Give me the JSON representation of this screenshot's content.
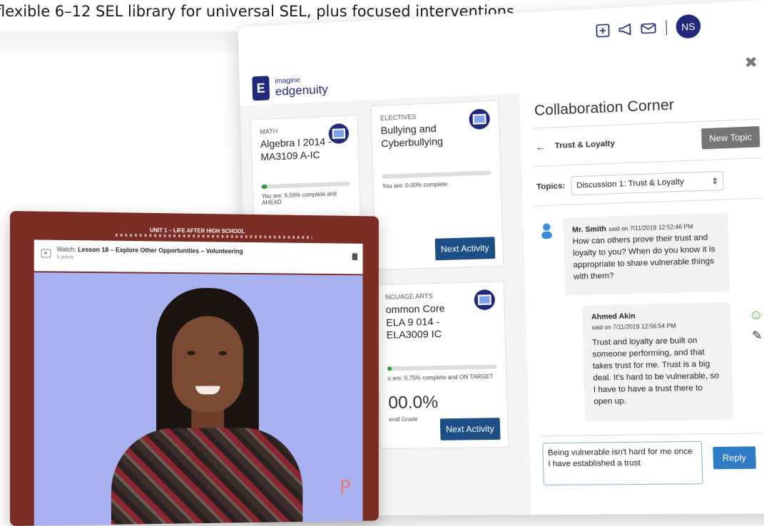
{
  "headline": "flexible 6–12 SEL library for universal SEL, plus focused interventions",
  "header": {
    "icons": [
      "plus-square-icon",
      "megaphone-icon",
      "envelope-icon"
    ],
    "avatar_initials": "NS"
  },
  "logo": {
    "small": "imagine",
    "big": "edgenuity"
  },
  "courses": [
    {
      "category": "MATH",
      "title": "Algebra I 2014 - MA3109 A-IC",
      "progress_percent": 6.56,
      "progress_text": "You are: 6.56% complete and AHEAD"
    },
    {
      "category": "ELECTIVES",
      "title": "Bullying and Cyberbullying",
      "progress_percent": 0,
      "progress_text": "You are: 0.00% complete",
      "button": "Next Activity"
    },
    {
      "category": "NGUAGE ARTS",
      "title": "ommon Core ELA 9 014 - ELA3009 IC",
      "progress_percent": 0.75,
      "progress_text": "u are: 0.75% complete and ON TARGET",
      "grade": "00.0%",
      "grade_label": "erall Grade",
      "button": "Next Activity"
    }
  ],
  "collab": {
    "title": "Collaboration Corner",
    "back_label": "Trust & Loyalty",
    "new_topic": "New Topic",
    "topics_label": "Topics:",
    "topic_selected": "Discussion 1: Trust & Loyalty",
    "messages": [
      {
        "author": "Mr. Smith",
        "meta": "said on 7/11/2019 12:52:46 PM",
        "body": "How can others prove their trust and loyalty to you? When do you know it is appropriate to share vulnerable things with them?"
      },
      {
        "author": "Ahmed Akin",
        "meta": "said on 7/11/2019 12:56:54 PM",
        "body": "Trust and loyalty are built on someone performing, and that takes trust for me. Trust is a big deal. It's hard to be vulnerable, so I have to have a trust there to open up."
      }
    ],
    "reply_text": "Being vulnerable isn't hard for me once I have established a trust",
    "reply_button": "Reply"
  },
  "video": {
    "unit_label": "UNIT 1 – LIFE AFTER HIGH SCHOOL",
    "watch_prefix": "Watch:",
    "lesson_title": "Lesson 18 – Explore Other Opportunities – Volunteering",
    "points": "5 points",
    "overlay_logo": "P"
  },
  "colors": {
    "brand": "#23297a",
    "button_blue": "#1d4f86",
    "reply_blue": "#2f7bc5",
    "video_frame": "#7b2c24"
  }
}
